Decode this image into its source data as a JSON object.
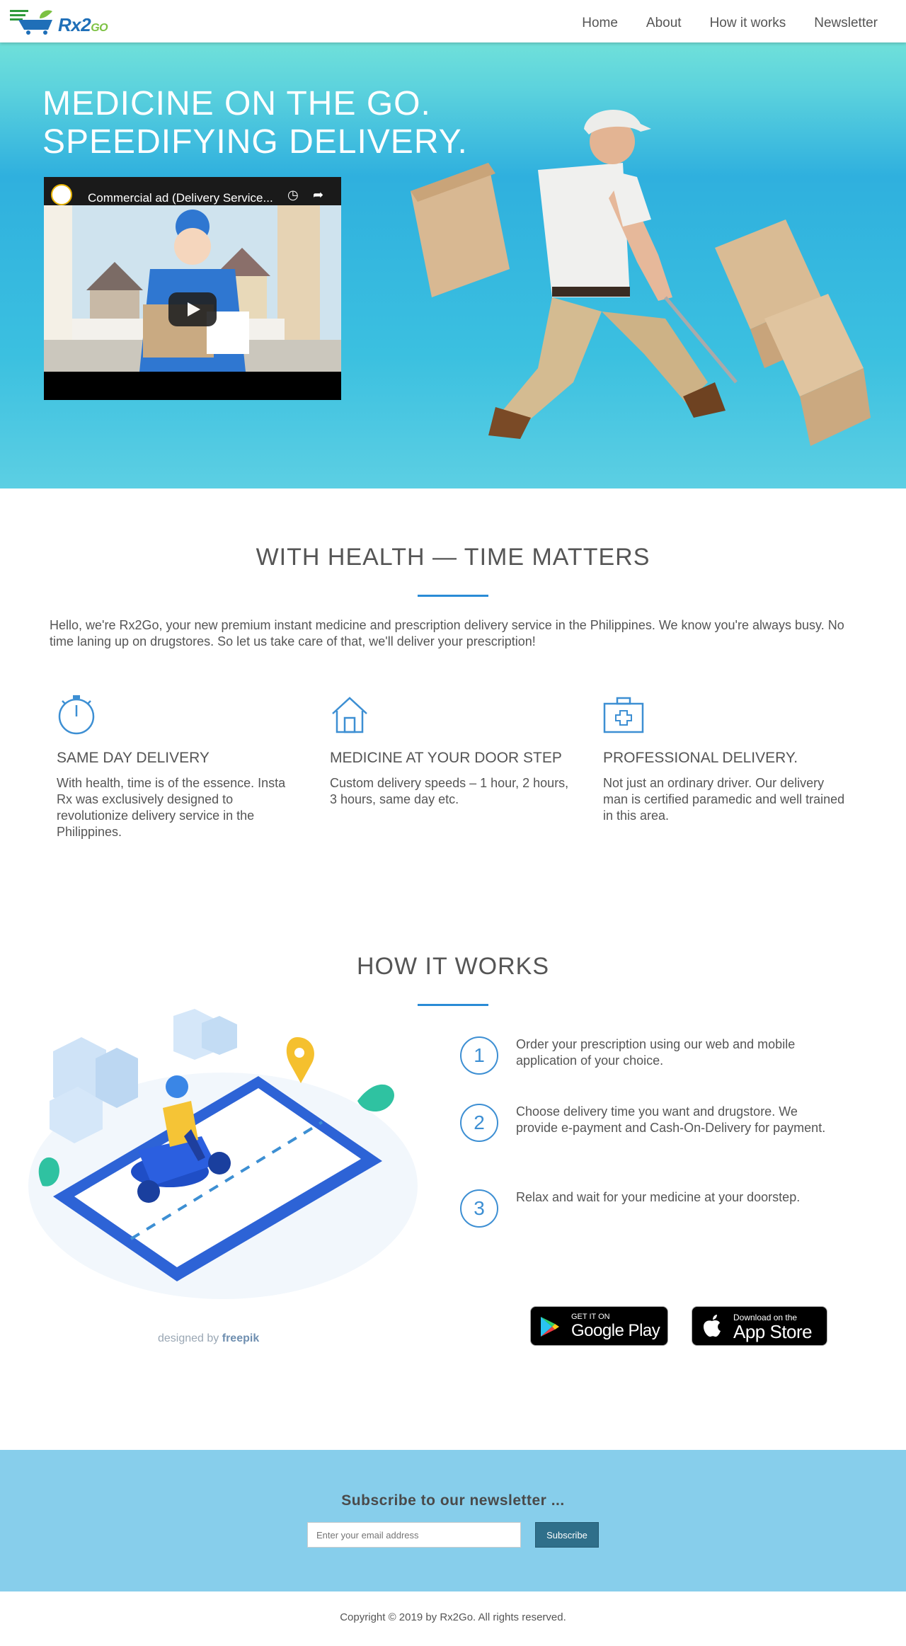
{
  "nav": {
    "logo_text": "Rx2",
    "logo_go": "GO",
    "links": [
      "Home",
      "About",
      "How it works",
      "Newsletter"
    ]
  },
  "hero": {
    "title_line1": "MEDICINE ON THE GO.",
    "title_line2": "SPEEDIFYING DELIVERY.",
    "video_title": "Commercial ad (Delivery Service..."
  },
  "about": {
    "title": "WITH HEALTH — TIME MATTERS",
    "intro": "Hello, we're Rx2Go, your new premium instant medicine and prescription delivery service in the Philippines. We know you're always busy. No time laning up on drugstores. So let us take care of that, we'll deliver your prescription!",
    "features": [
      {
        "icon": "stopwatch-icon",
        "title": "SAME DAY DELIVERY",
        "text": "With health, time is of the essence. Insta Rx was exclusively designed to revolutionize delivery service in the Philippines."
      },
      {
        "icon": "house-icon",
        "title": "MEDICINE AT YOUR DOOR STEP",
        "text": "Custom delivery speeds – 1 hour, 2 hours, 3 hours, same day etc."
      },
      {
        "icon": "medical-kit-icon",
        "title": "PROFESSIONAL DELIVERY.",
        "text": "Not just an ordinary driver. Our delivery man is certified paramedic and well trained in this area."
      }
    ]
  },
  "how": {
    "title": "HOW IT WORKS",
    "steps": [
      {
        "num": "1",
        "text": "Order your prescription using our web and mobile application of your choice."
      },
      {
        "num": "2",
        "text": "Choose delivery time you want and drugstore. We provide e-payment and Cash-On-Delivery for payment."
      },
      {
        "num": "3",
        "text": "Relax and wait for your medicine at your doorstep."
      }
    ],
    "credit_prefix": "designed by",
    "credit_brand": "freepik",
    "google_small": "GET IT ON",
    "google_big": "Google Play",
    "apple_small": "Download on the",
    "apple_big": "App Store"
  },
  "newsletter": {
    "title": "Subscribe to our newsletter ...",
    "placeholder": "Enter your email address",
    "button": "Subscribe"
  },
  "footer": {
    "copyright": "Copyright © 2019 by Rx2Go. All rights reserved."
  },
  "colors": {
    "accent": "#2a8bd6",
    "newsletter_bg": "#87ceeb",
    "button_bg": "#2f6f8a"
  }
}
